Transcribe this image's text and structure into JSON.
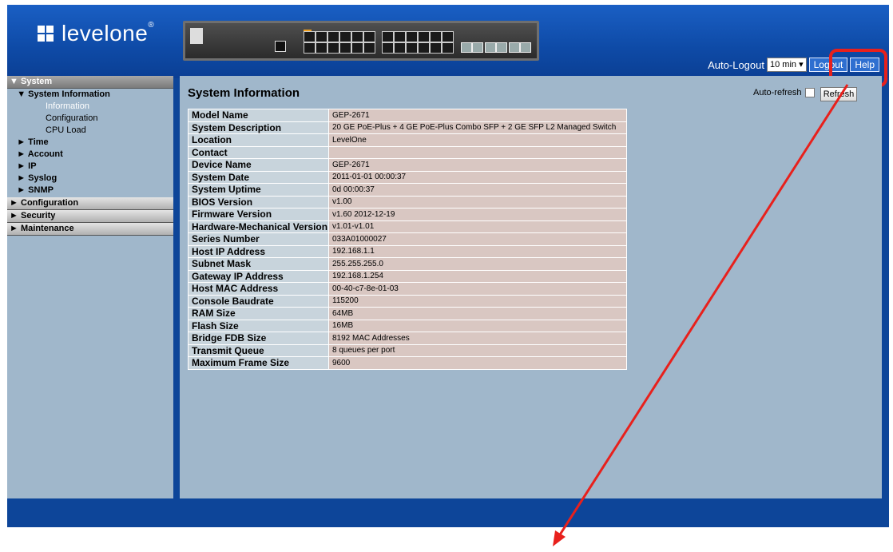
{
  "brand": {
    "logo_text": "levelone"
  },
  "device_image": {
    "label": "LevelOne GEP-2671 switch front panel"
  },
  "topbar": {
    "auto_logout_label": "Auto-Logout",
    "auto_logout_value": "10 min",
    "logout_label": "Logout",
    "help_label": "Help"
  },
  "sidebar": {
    "system": "System",
    "system_information": "System Information",
    "information": "Information",
    "configuration_sub": "Configuration",
    "cpu_load": "CPU Load",
    "time": "Time",
    "account": "Account",
    "ip": "IP",
    "syslog": "Syslog",
    "snmp": "SNMP",
    "configuration": "Configuration",
    "security": "Security",
    "maintenance": "Maintenance"
  },
  "main": {
    "title": "System Information",
    "auto_refresh_label": "Auto-refresh",
    "refresh_label": "Refresh",
    "rows": [
      {
        "key": "Model Name",
        "value": "GEP-2671"
      },
      {
        "key": "System Description",
        "value": "20 GE PoE-Plus + 4 GE PoE-Plus Combo SFP + 2 GE SFP L2 Managed Switch"
      },
      {
        "key": "Location",
        "value": "LevelOne"
      },
      {
        "key": "Contact",
        "value": ""
      },
      {
        "key": "Device Name",
        "value": "GEP-2671"
      },
      {
        "key": "System Date",
        "value": "2011-01-01 00:00:37"
      },
      {
        "key": "System Uptime",
        "value": "0d 00:00:37"
      },
      {
        "key": "BIOS Version",
        "value": "v1.00"
      },
      {
        "key": "Firmware Version",
        "value": "v1.60 2012-12-19"
      },
      {
        "key": "Hardware-Mechanical Version",
        "value": "v1.01-v1.01"
      },
      {
        "key": "Series Number",
        "value": "033A01000027"
      },
      {
        "key": "Host IP Address",
        "value": "192.168.1.1"
      },
      {
        "key": "Subnet Mask",
        "value": "255.255.255.0"
      },
      {
        "key": "Gateway IP Address",
        "value": "192.168.1.254"
      },
      {
        "key": "Host MAC Address",
        "value": "00-40-c7-8e-01-03"
      },
      {
        "key": "Console Baudrate",
        "value": "115200"
      },
      {
        "key": "RAM Size",
        "value": "64MB"
      },
      {
        "key": "Flash Size",
        "value": "16MB"
      },
      {
        "key": "Bridge FDB Size",
        "value": "8192 MAC Addresses"
      },
      {
        "key": "Transmit Queue",
        "value": "8 queues per port"
      },
      {
        "key": "Maximum Frame Size",
        "value": "9600"
      }
    ]
  },
  "annotation": {
    "highlight_color": "#e8201c"
  }
}
